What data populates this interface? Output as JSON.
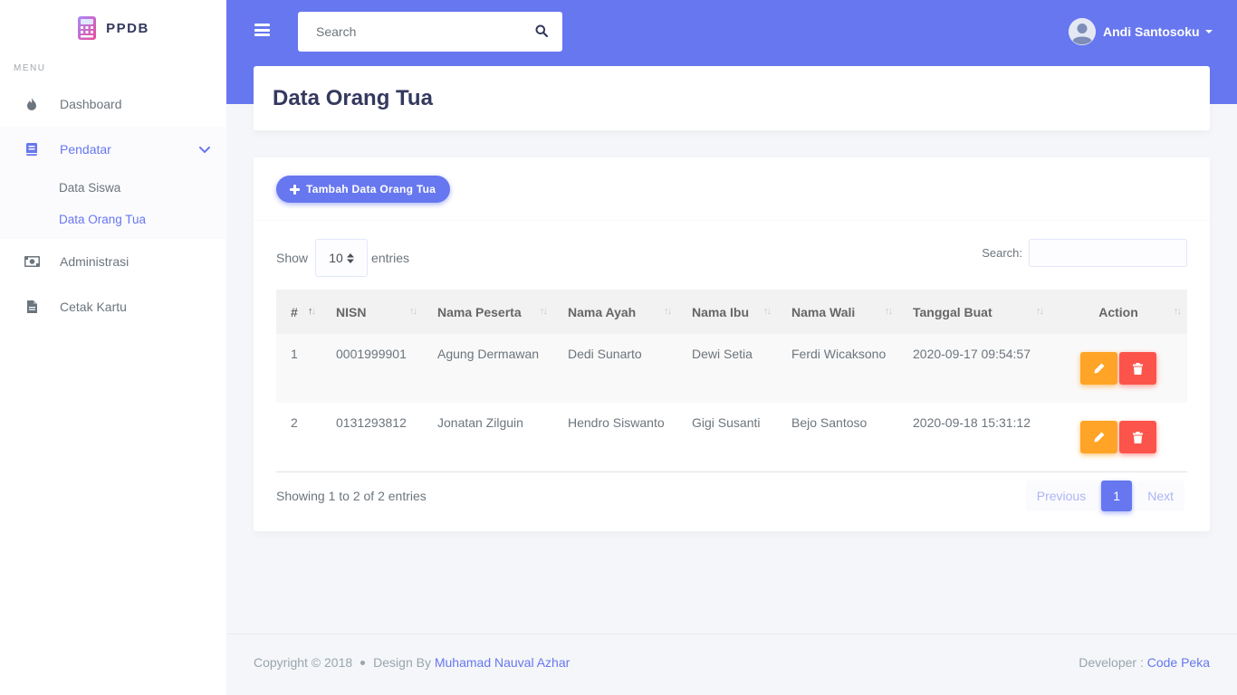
{
  "brand": {
    "name": "PPDB"
  },
  "sidebar": {
    "menu_header": "MENU",
    "items": [
      {
        "label": "Dashboard",
        "icon": "fire-icon"
      },
      {
        "label": "Pendatar",
        "icon": "book-icon",
        "active": true,
        "children": [
          {
            "label": "Data Siswa"
          },
          {
            "label": "Data Orang Tua",
            "active": true
          }
        ]
      },
      {
        "label": "Administrasi",
        "icon": "money-icon"
      },
      {
        "label": "Cetak Kartu",
        "icon": "file-icon"
      }
    ]
  },
  "navbar": {
    "search_placeholder": "Search",
    "user_name": "Andi Santosoku"
  },
  "page": {
    "title": "Data Orang Tua"
  },
  "card": {
    "add_button": "Tambah Data Orang Tua",
    "length": {
      "show": "Show",
      "value": "10",
      "entries": "entries"
    },
    "filter_label": "Search:",
    "table": {
      "headers": [
        "#",
        "NISN",
        "Nama Peserta",
        "Nama Ayah",
        "Nama Ibu",
        "Nama Wali",
        "Tanggal Buat",
        "Action"
      ],
      "rows": [
        [
          "1",
          "0001999901",
          "Agung Dermawan",
          "Dedi Sunarto",
          "Dewi Setia",
          "Ferdi Wicaksono",
          "2020-09-17 09:54:57"
        ],
        [
          "2",
          "0131293812",
          "Jonatan Zilguin",
          "Hendro Siswanto",
          "Gigi Susanti",
          "Bejo Santoso",
          "2020-09-18 15:31:12"
        ]
      ]
    },
    "info": "Showing 1 to 2 of 2 entries",
    "pagination": {
      "previous": "Previous",
      "current": "1",
      "next": "Next"
    }
  },
  "footer": {
    "copyright": "Copyright © 2018",
    "design_by": "Design By",
    "designer": "Muhamad Nauval Azhar",
    "developer_label": "Developer :",
    "developer": "Code Peka"
  },
  "colors": {
    "primary": "#6777ef",
    "warning": "#ffa426",
    "danger": "#fc544b"
  }
}
